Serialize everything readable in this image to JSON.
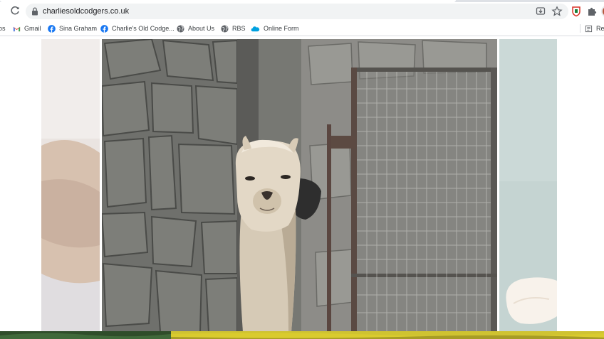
{
  "browser": {
    "url": "charliesoldcodgers.co.uk",
    "icons": {
      "forward": "forward-arrow-icon",
      "reload": "reload-icon",
      "lock": "lock-icon",
      "install": "install-app-icon",
      "bookmark": "star-icon",
      "extension_shield": "shield-extension-icon",
      "extensions": "puzzle-icon"
    }
  },
  "bookmarks": {
    "items": [
      {
        "label": "os",
        "icon": "apps-icon"
      },
      {
        "label": "Gmail",
        "icon": "gmail-icon"
      },
      {
        "label": "Sina Graham",
        "icon": "facebook-icon"
      },
      {
        "label": "Charlie's Old Codge...",
        "icon": "facebook-icon"
      },
      {
        "label": "About Us",
        "icon": "globe-icon"
      },
      {
        "label": "RBS",
        "icon": "globe-icon"
      },
      {
        "label": "Online Form",
        "icon": "salesforce-cloud-icon"
      }
    ],
    "reading_list": {
      "label": "Rea",
      "icon": "reading-list-icon"
    }
  },
  "colors": {
    "toolbar_bg": "#ffffff",
    "omnibox_bg": "#f1f3f4",
    "facebook_blue": "#1877f2",
    "gmail_red": "#ea4335",
    "salesforce_blue": "#00a1e0",
    "shield_red": "#d93025",
    "stone_gray": "#7b7b78",
    "alpaca_cream": "#ded3c2"
  },
  "carousel": {
    "main_slide": "alpaca-peeking-stone-wall-photo",
    "left_slide": "faded-previous-photo",
    "right_slide": "faded-next-photo"
  }
}
